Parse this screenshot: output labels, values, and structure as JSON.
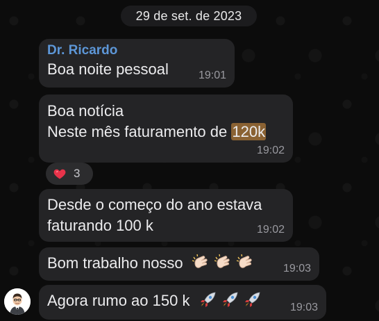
{
  "chat": {
    "date_label": "29 de set. de 2023",
    "sender_name": "Dr. Ricardo",
    "messages": [
      {
        "lines": [
          "Boa noite pessoal"
        ],
        "time": "19:01"
      },
      {
        "line1": "Boa notícia",
        "line2_prefix": "Neste mês faturamento de ",
        "line2_highlight": "120k",
        "time": "19:02"
      },
      {
        "lines": [
          "Desde o começo do ano estava",
          "faturando 100 k"
        ],
        "time": "19:02"
      },
      {
        "text": "Bom trabalho nosso",
        "emoji": "clapping-hands",
        "emoji_count": 3,
        "time": "19:03"
      },
      {
        "text": "Agora rumo ao 150 k",
        "emoji": "rocket",
        "emoji_count": 3,
        "time": "19:03"
      }
    ],
    "reaction": {
      "emoji": "heart",
      "count": "3"
    }
  },
  "colors": {
    "background": "#0c0c0c",
    "bubble": "#242426",
    "sender": "#5d97d8",
    "highlight": "#8a6233",
    "time": "#9a9aa0"
  }
}
